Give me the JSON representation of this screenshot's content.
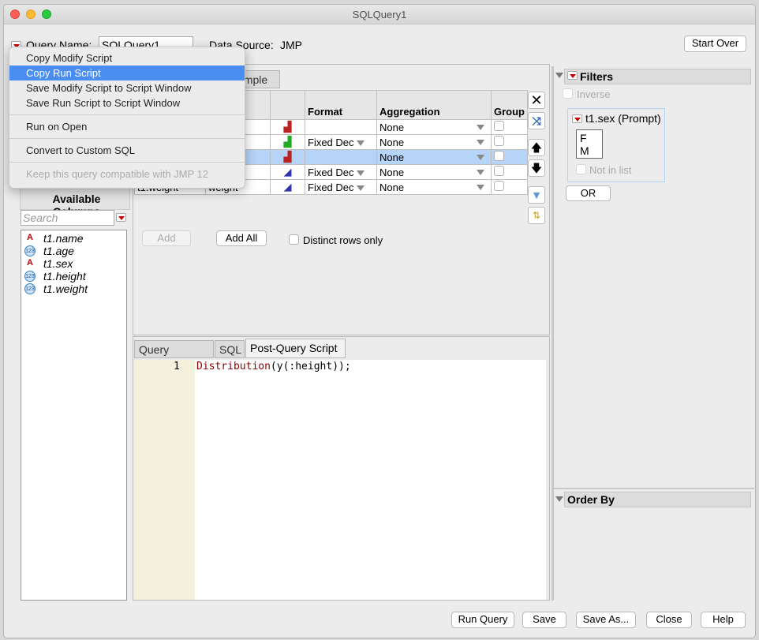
{
  "window": {
    "title": "SQLQuery1"
  },
  "header": {
    "query_name_label": "Query Name:",
    "query_name_value": "SQLQuery1",
    "data_source_label": "Data Source:",
    "data_source_value": "JMP",
    "start_over": "Start Over"
  },
  "menu": {
    "items": [
      {
        "label": "Copy Modify Script",
        "state": "normal"
      },
      {
        "label": "Copy Run Script",
        "state": "highlighted"
      },
      {
        "label": "Save Modify Script to Script Window",
        "state": "normal"
      },
      {
        "label": "Save Run Script to Script Window",
        "state": "normal"
      },
      {
        "label": "Run on Open",
        "state": "normal"
      },
      {
        "label": "Convert to Custom SQL",
        "state": "normal"
      },
      {
        "label": "Keep this query compatible with JMP 12",
        "state": "disabled"
      }
    ]
  },
  "tabs": {
    "sample_partial": "ample"
  },
  "left": {
    "title": "Available Columns",
    "search_placeholder": "Search",
    "columns": [
      {
        "name": "t1.name",
        "type": "character"
      },
      {
        "name": "t1.age",
        "type": "numeric"
      },
      {
        "name": "t1.sex",
        "type": "character"
      },
      {
        "name": "t1.height",
        "type": "numeric"
      },
      {
        "name": "t1.weight",
        "type": "numeric"
      }
    ]
  },
  "grid": {
    "headers": {
      "name_partial": "ame",
      "format": "Format",
      "aggregation": "Aggregation",
      "group": "Group"
    },
    "rows": [
      {
        "col": "",
        "name": "",
        "modeling": "nominal",
        "format": "",
        "aggregation": "None",
        "selected": false
      },
      {
        "col": "",
        "name": "",
        "modeling": "ordinal",
        "format": "Fixed Dec",
        "aggregation": "None",
        "selected": false
      },
      {
        "col": "",
        "name": "",
        "modeling": "nominal",
        "format": "",
        "aggregation": "None",
        "selected": true
      },
      {
        "col": "",
        "name": "",
        "modeling": "continuous",
        "format": "Fixed Dec",
        "aggregation": "None",
        "selected": false
      },
      {
        "col": "t1.weight",
        "name": "weight",
        "modeling": "continuous",
        "format": "Fixed Dec",
        "aggregation": "None",
        "selected": false
      }
    ],
    "add": "Add",
    "add_all": "Add All",
    "distinct": "Distinct rows only"
  },
  "script": {
    "tabs": [
      "Query Preview",
      "SQL",
      "Post-Query Script"
    ],
    "active": "Post-Query Script",
    "line_number": "1",
    "code_func": "Distribution",
    "code_rest": "(y(:height));"
  },
  "filters": {
    "title": "Filters",
    "inverse": "Inverse",
    "filter_title": "t1.sex (Prompt)",
    "values": [
      "F",
      "M"
    ],
    "not_in_list": "Not in list",
    "or": "OR"
  },
  "order_by": {
    "title": "Order By"
  },
  "footer": {
    "run_query": "Run Query",
    "save": "Save",
    "save_as": "Save As...",
    "close": "Close",
    "help": "Help"
  },
  "colors": {
    "highlight": "#4a8ef3",
    "selected_row": "#b5d4f8",
    "editor_gutter": "#f3f1dc"
  }
}
